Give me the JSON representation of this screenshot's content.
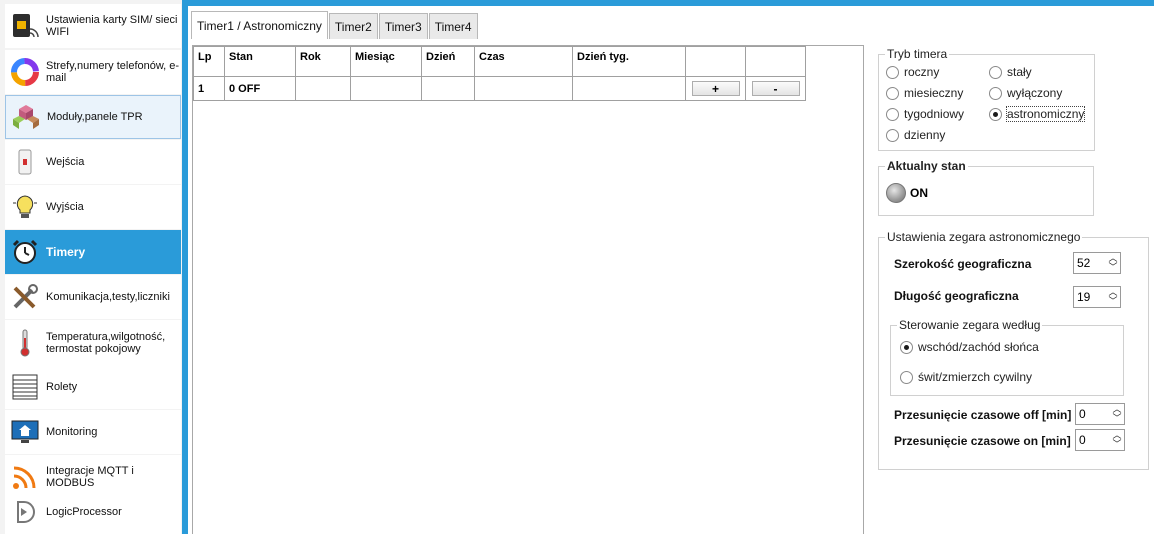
{
  "sidebar": {
    "items": [
      {
        "label": "Ustawienia karty SIM/ sieci WIFI",
        "icon": "sim-wifi-icon"
      },
      {
        "label": "Strefy,numery telefonów, e-mail",
        "icon": "zones-icon"
      },
      {
        "label": "Moduły,panele TPR",
        "icon": "modules-icon"
      },
      {
        "label": "Wejścia",
        "icon": "input-sensor-icon"
      },
      {
        "label": "Wyjścia",
        "icon": "lightbulb-icon"
      },
      {
        "label": "Timery",
        "icon": "alarm-clock-icon"
      },
      {
        "label": "Komunikacja,testy,liczniki",
        "icon": "tools-icon"
      },
      {
        "label": "Temperatura,wilgotność, termostat pokojowy",
        "icon": "thermometer-icon"
      },
      {
        "label": "Rolety",
        "icon": "blinds-icon"
      },
      {
        "label": "Monitoring",
        "icon": "monitor-icon"
      },
      {
        "label": "Integracje MQTT i MODBUS",
        "icon": "rss-icon"
      },
      {
        "label": "LogicProcessor",
        "icon": "logic-processor-icon"
      }
    ]
  },
  "tabs": [
    "Timer1 / Astronomiczny",
    "Timer2",
    "Timer3",
    "Timer4"
  ],
  "table": {
    "headers": [
      "Lp",
      "Stan",
      "Rok",
      "Miesiąc",
      "Dzień",
      "Czas",
      "Dzień tyg.",
      "",
      ""
    ],
    "rows": [
      {
        "lp": "1",
        "stan": "0 OFF",
        "add": "+",
        "remove": "-"
      }
    ]
  },
  "timer_mode": {
    "title": "Tryb timera",
    "options": [
      "roczny",
      "stały",
      "miesieczny",
      "wyłączony",
      "tygodniowy",
      "astronomiczny",
      "dzienny"
    ],
    "selected": "astronomiczny"
  },
  "current_state": {
    "title": "Aktualny stan",
    "value": "ON"
  },
  "astro": {
    "title": "Ustawienia zegara astronomicznego",
    "latitude_label": "Szerokość geograficzna",
    "latitude_value": "52",
    "longitude_label": "Długość geograficzna",
    "longitude_value": "19",
    "control_title": "Sterowanie zegara według",
    "control_options": [
      "wschód/zachód słońca",
      "świt/zmierzch cywilny"
    ],
    "control_selected": "wschód/zachód słońca",
    "offset_off_label": "Przesunięcie czasowe off [min]",
    "offset_off_value": "0",
    "offset_on_label": "Przesunięcie czasowe on [min]",
    "offset_on_value": "0"
  }
}
